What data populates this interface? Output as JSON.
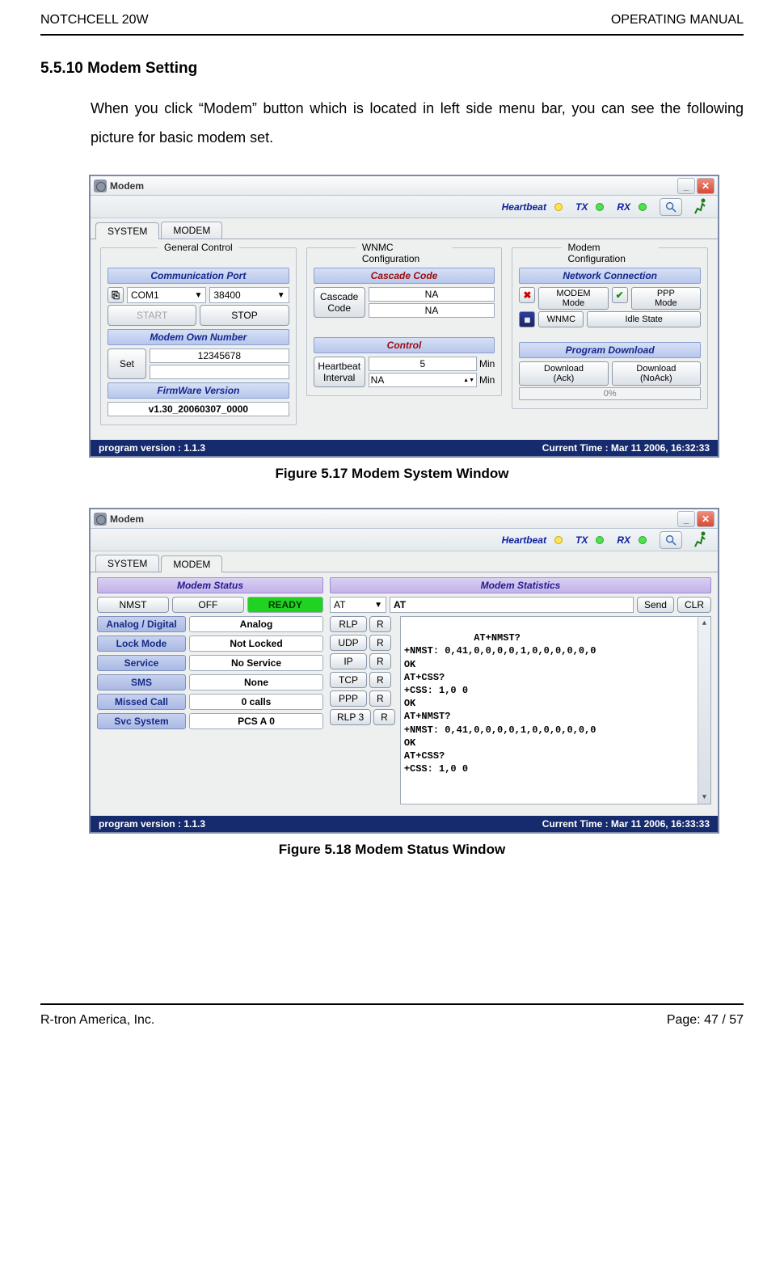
{
  "doc": {
    "header_left": "NOTCHCELL 20W",
    "header_right": "OPERATING MANUAL",
    "footer_left": "R-tron America, Inc.",
    "footer_right": "Page: 47 / 57",
    "section_title": "5.5.10 Modem Setting",
    "intro": "When you click “Modem” button which is located in left side menu bar, you can see the following picture for basic modem set.",
    "caption1": "Figure 5.17 Modem System Window",
    "caption2": "Figure 5.18 Modem Status Window"
  },
  "window": {
    "title": "Modem",
    "toolbar": {
      "heartbeat": "Heartbeat",
      "tx": "TX",
      "rx": "RX"
    },
    "statusbar": {
      "version_label": "program version :",
      "version": "1.1.3"
    }
  },
  "fig1": {
    "tabs": [
      "SYSTEM",
      "MODEM"
    ],
    "active_tab": 0,
    "cols": {
      "general": {
        "title": "General Control",
        "comm_hdr": "Communication Port",
        "com": "COM1",
        "baud": "38400",
        "start": "START",
        "stop": "STOP",
        "own_hdr": "Modem Own Number",
        "set": "Set",
        "own_number": "12345678",
        "fw_hdr": "FirmWare Version",
        "fw": "v1.30_20060307_0000"
      },
      "wnmc": {
        "title": "WNMC Configuration",
        "cascade_hdr": "Cascade Code",
        "cascade_btn": "Cascade\nCode",
        "na1": "NA",
        "na2": "NA",
        "control_hdr": "Control",
        "hb_btn": "Heartbeat\nInterval",
        "hb_val": "5",
        "min": "Min",
        "hb_na": "NA"
      },
      "modem": {
        "title": "Modem Configuration",
        "net_hdr": "Network Connection",
        "modem_mode": "MODEM\nMode",
        "ppp_mode": "PPP\nMode",
        "wnmc": "WNMC",
        "idle": "Idle State",
        "prog_hdr": "Program Download",
        "dl_ack": "Download\n(Ack)",
        "dl_noack": "Download\n(NoAck)",
        "pct": "0%"
      }
    },
    "status_time": "Current Time : Mar 11 2006, 16:32:33"
  },
  "fig2": {
    "tabs": [
      "SYSTEM",
      "MODEM"
    ],
    "active_tab": 1,
    "status": {
      "hdr": "Modem Status",
      "nmst": "NMST",
      "off": "OFF",
      "ready": "READY",
      "rows": [
        {
          "label": "Analog / Digital",
          "value": "Analog"
        },
        {
          "label": "Lock  Mode",
          "value": "Not Locked"
        },
        {
          "label": "Service",
          "value": "No Service"
        },
        {
          "label": "SMS",
          "value": "None"
        },
        {
          "label": "Missed Call",
          "value": "0 calls"
        },
        {
          "label": "Svc System",
          "value": "PCS A 0"
        }
      ]
    },
    "stats": {
      "hdr": "Modem Statistics",
      "at_sel": "AT",
      "at_field": "AT",
      "send": "Send",
      "clr": "CLR",
      "protocols": [
        "RLP",
        "UDP",
        "IP",
        "TCP",
        "PPP",
        "RLP 3"
      ],
      "r": "R",
      "log": "AT+NMST?\n+NMST: 0,41,0,0,0,0,1,0,0,0,0,0,0\nOK\nAT+CSS?\n+CSS: 1,0 0\nOK\nAT+NMST?\n+NMST: 0,41,0,0,0,0,1,0,0,0,0,0,0\nOK\nAT+CSS?\n+CSS: 1,0 0"
    },
    "status_time": "Current Time : Mar 11 2006, 16:33:33"
  }
}
